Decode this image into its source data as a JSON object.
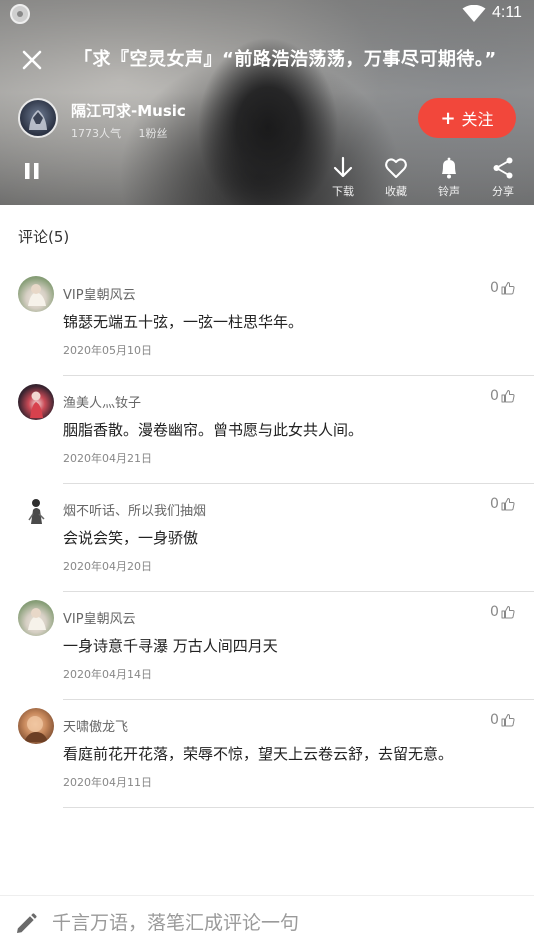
{
  "status_bar": {
    "time": "4:11",
    "icons": [
      "app-notification-icon",
      "wifi-icon"
    ]
  },
  "header": {
    "song_title": "「求『空灵女声』“前路浩浩荡荡，万事尽可期待。”",
    "close_icon": "close-icon"
  },
  "artist": {
    "name": "隔江可求-Music",
    "popularity": "1773人气",
    "fans": "1粉丝",
    "follow_label": "关注",
    "follow_plus": "+"
  },
  "actions": [
    {
      "label": "下载",
      "icon": "download-icon"
    },
    {
      "label": "收藏",
      "icon": "heart-icon"
    },
    {
      "label": "铃声",
      "icon": "bell-icon"
    },
    {
      "label": "分享",
      "icon": "share-icon"
    }
  ],
  "comments": {
    "header": "评论(5)",
    "items": [
      {
        "user": "VIP皇朝风云",
        "text": "锦瑟无端五十弦，一弦一柱思华年。",
        "date": "2020年05月10日",
        "likes": "0"
      },
      {
        "user": "渔美人灬钕子",
        "text": "胭脂香散。漫卷幽帘。曾书愿与此女共人间。",
        "date": "2020年04月21日",
        "likes": "0"
      },
      {
        "user": "烟不听话、所以我们抽烟",
        "text": "会说会笑，一身骄傲",
        "date": "2020年04月20日",
        "likes": "0"
      },
      {
        "user": "VIP皇朝风云",
        "text": "一身诗意千寻瀑 万古人间四月天",
        "date": "2020年04月14日",
        "likes": "0"
      },
      {
        "user": "天啸傲龙飞",
        "text": "看庭前花开花落，荣辱不惊，望天上云卷云舒，去留无意。",
        "date": "2020年04月11日",
        "likes": "0"
      }
    ]
  },
  "comment_input": {
    "placeholder": "千言万语，落笔汇成评论一句",
    "value": ""
  },
  "colors": {
    "accent": "#f2473b",
    "divider": "#dedede",
    "text_primary": "#222222",
    "text_secondary": "#888888"
  }
}
